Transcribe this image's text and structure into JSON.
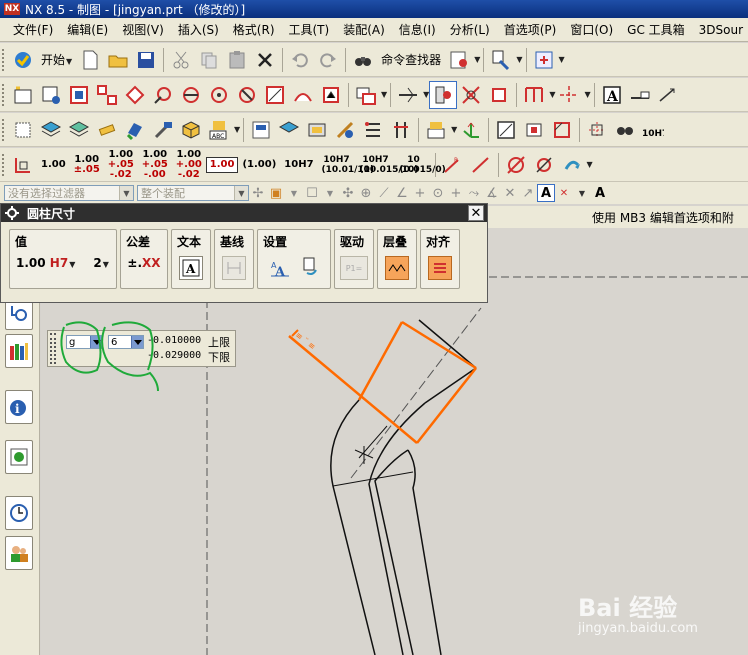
{
  "window": {
    "title": "NX 8.5 - 制图 - [jingyan.prt （修改的）]"
  },
  "menubar": {
    "items": [
      "文件(F)",
      "编辑(E)",
      "视图(V)",
      "插入(S)",
      "格式(R)",
      "工具(T)",
      "装配(A)",
      "信息(I)",
      "分析(L)",
      "首选项(P)",
      "窗口(O)",
      "GC 工具箱",
      "3DSour"
    ]
  },
  "toolbar1": {
    "start_label": "开始",
    "finder_label": "命令查找器"
  },
  "toolbar4": {
    "tolerances": [
      {
        "top": "1.00",
        "sub": ""
      },
      {
        "top": "1.00",
        "sub": "±.05"
      },
      {
        "top": "1.00",
        "sub": "+.05 -.02"
      },
      {
        "top": "1.00",
        "sub": "+.05 -.00"
      },
      {
        "top": "1.00",
        "sub": "+.00 -.02"
      }
    ],
    "boxed": "1.00",
    "paren": "(1.00)",
    "h7": "10H7",
    "h7b": "10H7 (10.01/10)",
    "h7c": "10H7 (10.015/10)",
    "limits": "10 (0.015/0)"
  },
  "filterbar": {
    "filter_placeholder": "没有选择过滤器",
    "assembly_placeholder": "整个装配"
  },
  "statusbar": {
    "text": "使用 MB3 编辑首选项和附"
  },
  "dialog": {
    "title": "圆柱尺寸",
    "groups": {
      "value": {
        "label": "值",
        "value": "1.00",
        "type": "H7",
        "decimals": "2"
      },
      "tolerance": {
        "label": "公差",
        "value": "±.XX"
      },
      "text": {
        "label": "文本"
      },
      "baseline": {
        "label": "基线"
      },
      "settings": {
        "label": "设置"
      },
      "driver": {
        "label": "驱动",
        "value": "P1="
      },
      "layer": {
        "label": "层叠"
      },
      "align": {
        "label": "对齐"
      }
    }
  },
  "tolerance_panel": {
    "grade_letter": "g",
    "grade_number": "6",
    "upper_value": "-0.010000",
    "lower_value": "-0.029000",
    "upper_label": "上限",
    "lower_label": "下限"
  },
  "watermark": {
    "brand": "Bai 经验",
    "url": "jingyan.baidu.com"
  },
  "colors": {
    "accent_orange": "#ff6a00",
    "annotation_green": "#1faa3a",
    "title_blue": "#0a2f7d"
  }
}
